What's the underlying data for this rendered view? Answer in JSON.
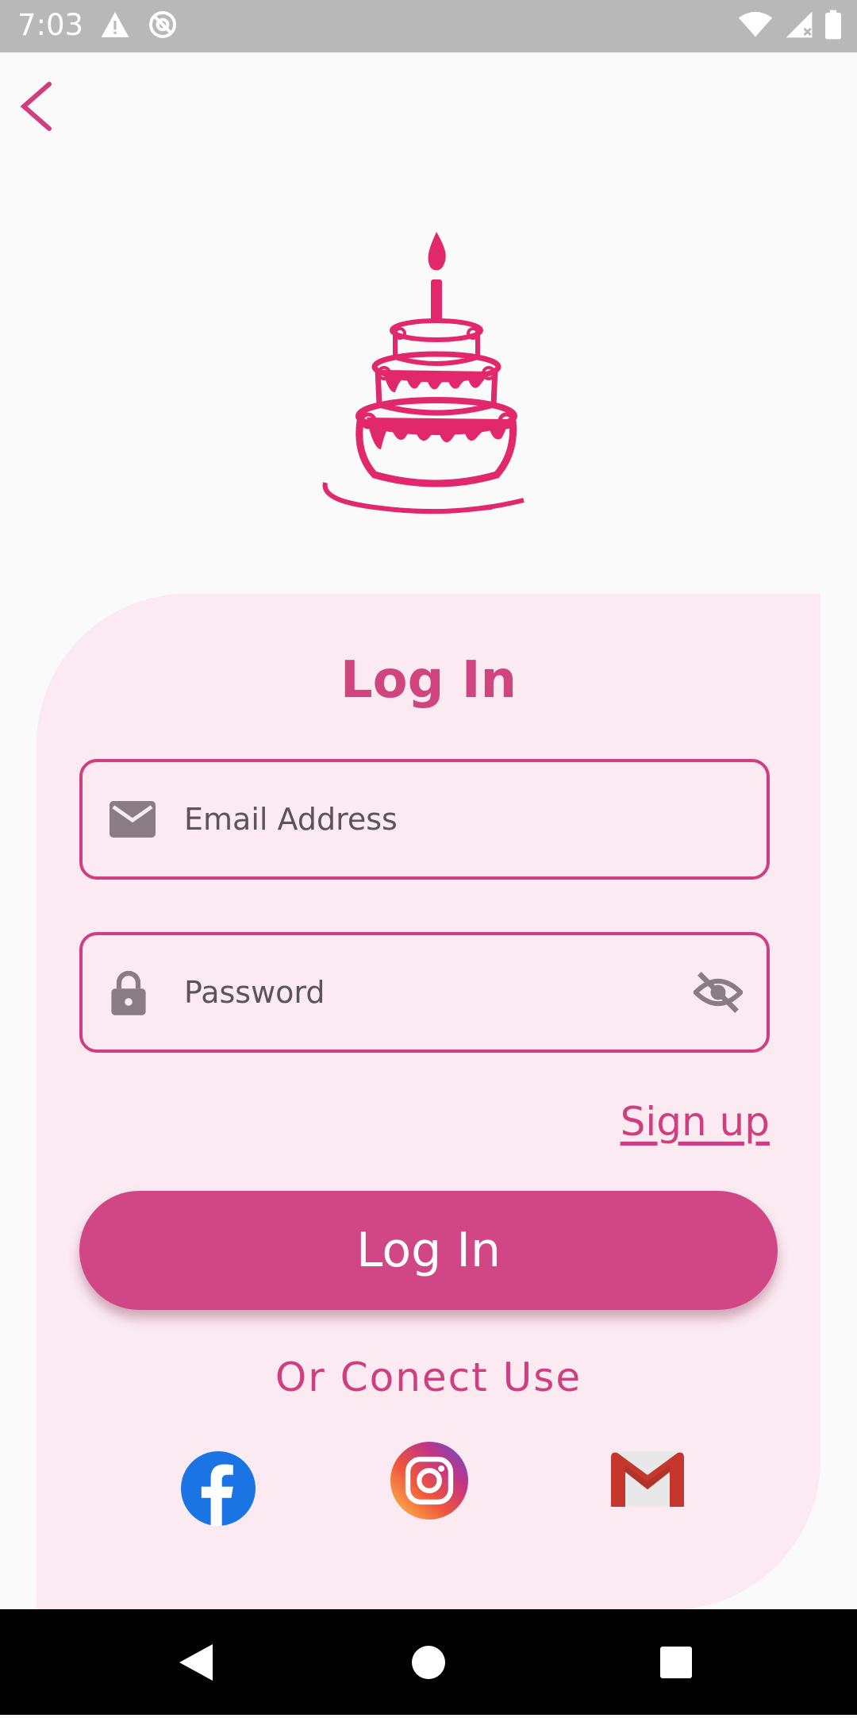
{
  "status_bar": {
    "time": "7:03",
    "left_icons": [
      "warning-icon",
      "no-sync-icon"
    ],
    "right_icons": [
      "wifi-icon",
      "signal-icon",
      "battery-icon"
    ]
  },
  "header": {
    "back_icon": "chevron-left-icon"
  },
  "logo": {
    "icon": "birthday-cake-logo",
    "color": "#e0286a"
  },
  "login_card": {
    "title": "Log In",
    "email": {
      "placeholder": "Email Address",
      "value": "",
      "icon": "mail-icon"
    },
    "password": {
      "placeholder": "Password",
      "value": "",
      "icon": "lock-icon",
      "toggle_icon": "eye-off-icon"
    },
    "signup_label": "Sign up",
    "login_button_label": "Log In",
    "or_connect_label": "Or Conect Use",
    "social": [
      "facebook-icon",
      "instagram-icon",
      "gmail-icon"
    ]
  },
  "nav_bar": {
    "buttons": [
      "back-triangle-icon",
      "home-circle-icon",
      "recents-square-icon"
    ]
  },
  "colors": {
    "accent": "#d14685",
    "card_bg": "#fbeaf1",
    "page_bg": "#fafafa"
  }
}
